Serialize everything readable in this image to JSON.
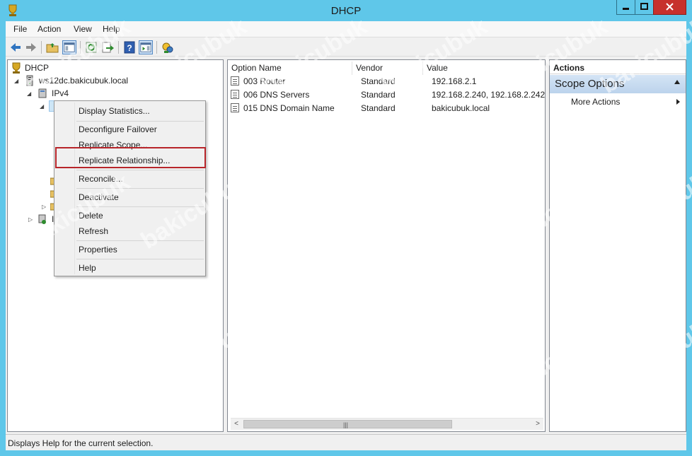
{
  "window": {
    "title": "DHCP"
  },
  "menubar": {
    "items": [
      "File",
      "Action",
      "View",
      "Help"
    ]
  },
  "tree": {
    "root": "DHCP",
    "server": "ws12dc.bakicubuk.local",
    "ipv4": "IPv4",
    "ipv6_partial": "I"
  },
  "list": {
    "columns": [
      "Option Name",
      "Vendor",
      "Value"
    ],
    "rows": [
      {
        "name": "003 Router",
        "vendor": "Standard",
        "value": "192.168.2.1"
      },
      {
        "name": "006 DNS Servers",
        "vendor": "Standard",
        "value": "192.168.2.240, 192.168.2.242"
      },
      {
        "name": "015 DNS Domain Name",
        "vendor": "Standard",
        "value": "bakicubuk.local"
      }
    ],
    "scroll_grip": "|||"
  },
  "actions": {
    "title": "Actions",
    "section": "Scope Options",
    "more": "More Actions"
  },
  "context_menu": {
    "items": [
      "Display Statistics...",
      "Deconfigure Failover",
      "Replicate Scope...",
      "Replicate Relationship...",
      "Reconcile...",
      "Deactivate",
      "Delete",
      "Refresh",
      "Properties",
      "Help"
    ],
    "highlighted": "Replicate Relationship..."
  },
  "status": {
    "text": "Displays Help for the current selection."
  },
  "watermark": "bakicubuk",
  "colors": {
    "titlebar": "#5fc7e9",
    "close_button": "#c7312c",
    "highlight_border": "#b8252a",
    "actions_header": "#c9dcf1"
  }
}
